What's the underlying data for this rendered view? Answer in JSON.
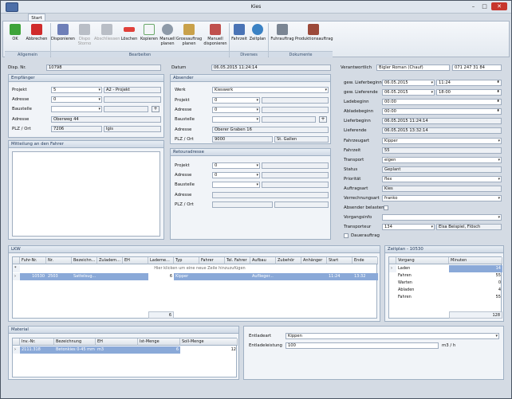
{
  "window": {
    "title": "Kies",
    "tab": "Start"
  },
  "ribbon": {
    "groups": [
      "Allgemein",
      "Bearbeiten",
      "Diverses",
      "Dokumente"
    ],
    "ok": "OK",
    "cancel": "Abbrechen",
    "dispatch": "Disponieren",
    "undispatch": "Dispo Storno",
    "close": "Abschliessen",
    "delete": "Löschen",
    "copy": "Kopieren",
    "manual_plan": "Manuell planen",
    "big_order_plan": "Grossauftrag planen",
    "manual_dispatch": "Manuell disponieren",
    "drive_time": "Fahrzeit",
    "timeplan": "Zeitplan",
    "delivery_order": "Fuhrauftrag",
    "production_order": "Produktionsauftrag"
  },
  "header": {
    "dispo_label": "Disp. Nr.",
    "dispo_value": "10798",
    "date_label": "Datum",
    "date_value": "06.05.2015 11:24:14",
    "resp_label": "Verantwortlich",
    "resp_value": "Bigler Roman (Chauf)",
    "phone_value": "071 247 31 84"
  },
  "empfaenger": {
    "title": "Empfänger",
    "projekt_label": "Projekt",
    "projekt_value": "5",
    "projekt_name": "A2 - Projekt",
    "adresse_label": "Adresse",
    "adresse_value": "0",
    "baustelle_label": "Baustelle",
    "adresse2_label": "Adresse",
    "adresse2_value": "Oberweg 44",
    "plz_label": "PLZ / Ort",
    "plz_value": "7206",
    "ort_value": "Igis",
    "plus": "+"
  },
  "mitteilung": {
    "title": "Mitteilung an den Fahrer"
  },
  "absender": {
    "title": "Absender",
    "werk_label": "Werk",
    "werk_value": "Kieswerk",
    "projekt_label": "Projekt",
    "projekt_value": "0",
    "adresse_label": "Adresse",
    "adresse_value": "0",
    "baustelle_label": "Baustelle",
    "adresse2_label": "Adresse",
    "adresse2_value": "Oberer Graben 16",
    "plz_label": "PLZ / Ort",
    "plz_value": "9000",
    "ort_value": "St. Gallen",
    "plus": "+"
  },
  "retour": {
    "title": "Retouradresse",
    "projekt_label": "Projekt",
    "projekt_value": "0",
    "adresse_label": "Adresse",
    "adresse_value": "0",
    "baustelle_label": "Baustelle",
    "adresse2_label": "Adresse",
    "plz_label": "PLZ / Ort"
  },
  "right": {
    "lb_label": "gew. Lieferbeginn",
    "lb_date": "06.05.2015",
    "lb_time": "11:24",
    "le_label": "gew. Lieferende",
    "le_date": "06.05.2015",
    "le_time": "18:00",
    "ladeb_label": "Ladebeginn",
    "ladeb_value": "00:00",
    "ablade_label": "Abladebeginn",
    "ablade_value": "00:00",
    "lieferb_label": "Lieferbeginn",
    "lieferb_value": "06.05.2015 11:24:14",
    "liefere_label": "Lieferende",
    "liefere_value": "06.05.2015 13:32:14",
    "fzart_label": "Fahrzeugart",
    "fzart_value": "Kipper",
    "fahrzeit_label": "Fahrzeit",
    "fahrzeit_value": "55",
    "transport_label": "Transport",
    "transport_value": "eigen",
    "status_label": "Status",
    "status_value": "Geplant",
    "prio_label": "Priorität",
    "prio_value": "flex",
    "auftragsart_label": "Auftragsart",
    "auftragsart_value": "Kies",
    "verrechnung_label": "Verrechnungsart",
    "verrechnung_value": "franko",
    "absender_label": "Absender belasten",
    "vorgang_label": "Vorgangsinfo",
    "transporteur_label": "Transporteur",
    "transporteur_value": "134",
    "transporteur_name": "Elsa Beispiel, Flösch",
    "dauer_label": "Dauerauftrag"
  },
  "lkw": {
    "title": "LKW",
    "columns": [
      "Fuhr-Nr.",
      "Nr.",
      "Bezeichn...",
      "Zuladem...",
      "EH",
      "Lademe...",
      "Typ",
      "Fahrer",
      "Tel. Fahrer",
      "Aufbau",
      "Zubehör",
      "Anhänger",
      "Start",
      "Ende"
    ],
    "new_row": "Hier klicken um eine neue Zeile hinzuzufügen",
    "row": {
      "fuhr": "10530",
      "nr": "2503",
      "bez": "Sattelsug...",
      "lademe": "6",
      "typ": "Kipper",
      "aufbau": "Auflieger...",
      "start": "11:24",
      "ende": "13:32"
    },
    "total": "6"
  },
  "zeitplan": {
    "title": "Zeitplan - 10530",
    "col1": "Vorgang",
    "col2": "Minuten",
    "rows": [
      {
        "v": "Laden",
        "m": "14"
      },
      {
        "v": "Fahren",
        "m": "55"
      },
      {
        "v": "Warten",
        "m": "0"
      },
      {
        "v": "Abladen",
        "m": "4"
      },
      {
        "v": "Fahren",
        "m": "55"
      }
    ],
    "total": "128"
  },
  "material": {
    "title": "Material",
    "columns": [
      "Inv.-Nr.",
      "Bezeichnung",
      "EH",
      "Ist-Menge",
      "Soll-Menge"
    ],
    "row": {
      "inv": "2111.318",
      "bez": "Betonkies 0-45 mm",
      "eh": "m3",
      "ist": "6",
      "soll": "12"
    }
  },
  "entlade": {
    "art_label": "Entladeart",
    "art_value": "Kippen",
    "leist_label": "Entladeleistung",
    "leist_value": "100",
    "leist_unit": "m3 / h"
  },
  "colors": {
    "accent": "#8aa9d8",
    "header": "#1d3557"
  }
}
